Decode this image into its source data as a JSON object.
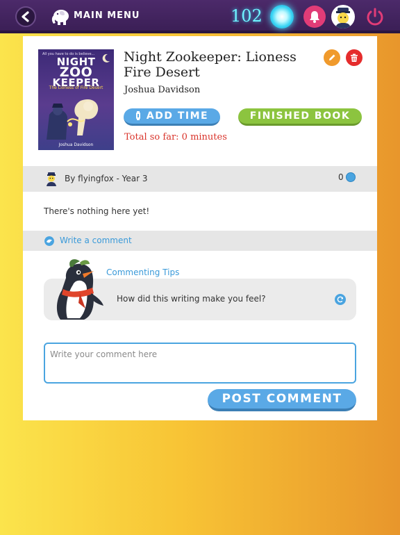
{
  "topbar": {
    "back_icon": "chevron-left-icon",
    "logo_icon": "elephant-icon",
    "menu_label": "MAIN MENU",
    "points": "102",
    "orb_icon": "glowing-orb-icon",
    "bell_icon": "bell-icon",
    "avatar_icon": "zookeeper-avatar-icon",
    "power_icon": "power-icon",
    "colors": {
      "bar": "#3b1f56",
      "points": "#6ff3ff",
      "bell": "#e13c77",
      "power": "#e13c77"
    }
  },
  "book": {
    "cover": {
      "tagline": "All you have to do is believe...",
      "title_line1": "NIGHT",
      "title_line2": "ZOO",
      "title_line3": "KEEPER",
      "subtitle": "The Lioness of Fire Desert",
      "author": "Joshua Davidson"
    },
    "title": "Night Zookeeper: Lioness Fire Desert",
    "author": "Joshua Davidson",
    "edit_icon": "pencil-icon",
    "delete_icon": "trash-icon",
    "add_time_label": "ADD TIME",
    "add_time_icon": "lantern-icon",
    "finished_label": "FINISHED BOOK",
    "total_text": "Total so far: 0 minutes",
    "colors": {
      "add_time": "#5aa9e6",
      "finished": "#8cc43f",
      "total": "#d9342b",
      "edit": "#f09a2c",
      "delete": "#e52c2c"
    }
  },
  "byline": {
    "text": "By flyingfox - Year 3",
    "comment_count": "0",
    "avatar_icon": "zookeeper-avatar-icon",
    "count_icon": "speech-bubble-icon"
  },
  "comments": {
    "empty_text": "There's nothing here yet!",
    "write_label": "Write a comment",
    "write_icon": "bird-icon"
  },
  "tips": {
    "title": "Commenting Tips",
    "text": "How did this writing make you feel?",
    "refresh_icon": "refresh-icon",
    "mascot_icon": "penguin-icon"
  },
  "composer": {
    "placeholder": "Write your comment here",
    "value": "",
    "post_label": "POST COMMENT"
  }
}
